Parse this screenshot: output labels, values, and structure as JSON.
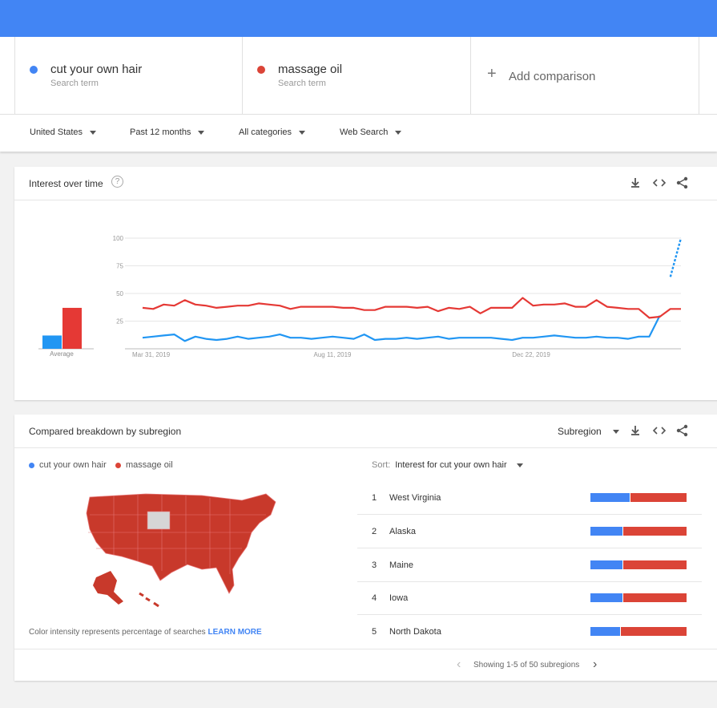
{
  "colors": {
    "blue": "#4285f4",
    "red": "#db4437",
    "chart_blue": "#2196f3",
    "chart_red": "#e53935"
  },
  "terms": [
    {
      "name": "cut your own hair",
      "sub": "Search term",
      "color": "#4285f4"
    },
    {
      "name": "massage oil",
      "sub": "Search term",
      "color": "#db4437"
    }
  ],
  "add_comparison": "Add comparison",
  "filters": {
    "region": "United States",
    "time": "Past 12 months",
    "category": "All categories",
    "search": "Web Search"
  },
  "interest": {
    "title": "Interest over time",
    "help_icon": "?",
    "average_label": "Average"
  },
  "chart_data": {
    "type": "line",
    "ylim": [
      0,
      100
    ],
    "yticks": [
      "100",
      "75",
      "50",
      "25"
    ],
    "xticks": [
      "Mar 31, 2019",
      "Aug 11, 2019",
      "Dec 22, 2019"
    ],
    "series": [
      {
        "name": "cut your own hair",
        "color": "#2196f3",
        "average": 12,
        "values": [
          10,
          11,
          12,
          13,
          7,
          11,
          9,
          8,
          9,
          11,
          9,
          10,
          11,
          13,
          10,
          10,
          9,
          10,
          11,
          10,
          9,
          13,
          8,
          9,
          9,
          10,
          9,
          10,
          11,
          9,
          10,
          10,
          10,
          10,
          9,
          8,
          10,
          10,
          11,
          12,
          11,
          10,
          10,
          11,
          10,
          10,
          9,
          11,
          11,
          30,
          65,
          100
        ]
      },
      {
        "name": "massage oil",
        "color": "#e53935",
        "average": 37,
        "values": [
          37,
          36,
          40,
          39,
          44,
          40,
          39,
          37,
          38,
          39,
          39,
          41,
          40,
          39,
          36,
          38,
          38,
          38,
          38,
          37,
          37,
          35,
          35,
          38,
          38,
          38,
          37,
          38,
          34,
          37,
          36,
          38,
          32,
          37,
          37,
          37,
          46,
          39,
          40,
          40,
          41,
          38,
          38,
          44,
          38,
          37,
          36,
          36,
          28,
          29,
          36,
          36
        ]
      }
    ]
  },
  "subregion": {
    "title": "Compared breakdown by subregion",
    "dropdown": "Subregion",
    "legend": [
      "cut your own hair",
      "massage oil"
    ],
    "sort_label": "Sort:",
    "sort_value": "Interest for cut your own hair",
    "rows": [
      {
        "rank": "1",
        "name": "West Virginia",
        "blue": 41,
        "red": 59
      },
      {
        "rank": "2",
        "name": "Alaska",
        "blue": 33,
        "red": 67
      },
      {
        "rank": "3",
        "name": "Maine",
        "blue": 33,
        "red": 67
      },
      {
        "rank": "4",
        "name": "Iowa",
        "blue": 33,
        "red": 67
      },
      {
        "rank": "5",
        "name": "North Dakota",
        "blue": 31,
        "red": 69
      }
    ],
    "note": "Color intensity represents percentage of searches",
    "learn_more": "LEARN MORE",
    "pager": "Showing 1-5 of 50 subregions"
  }
}
